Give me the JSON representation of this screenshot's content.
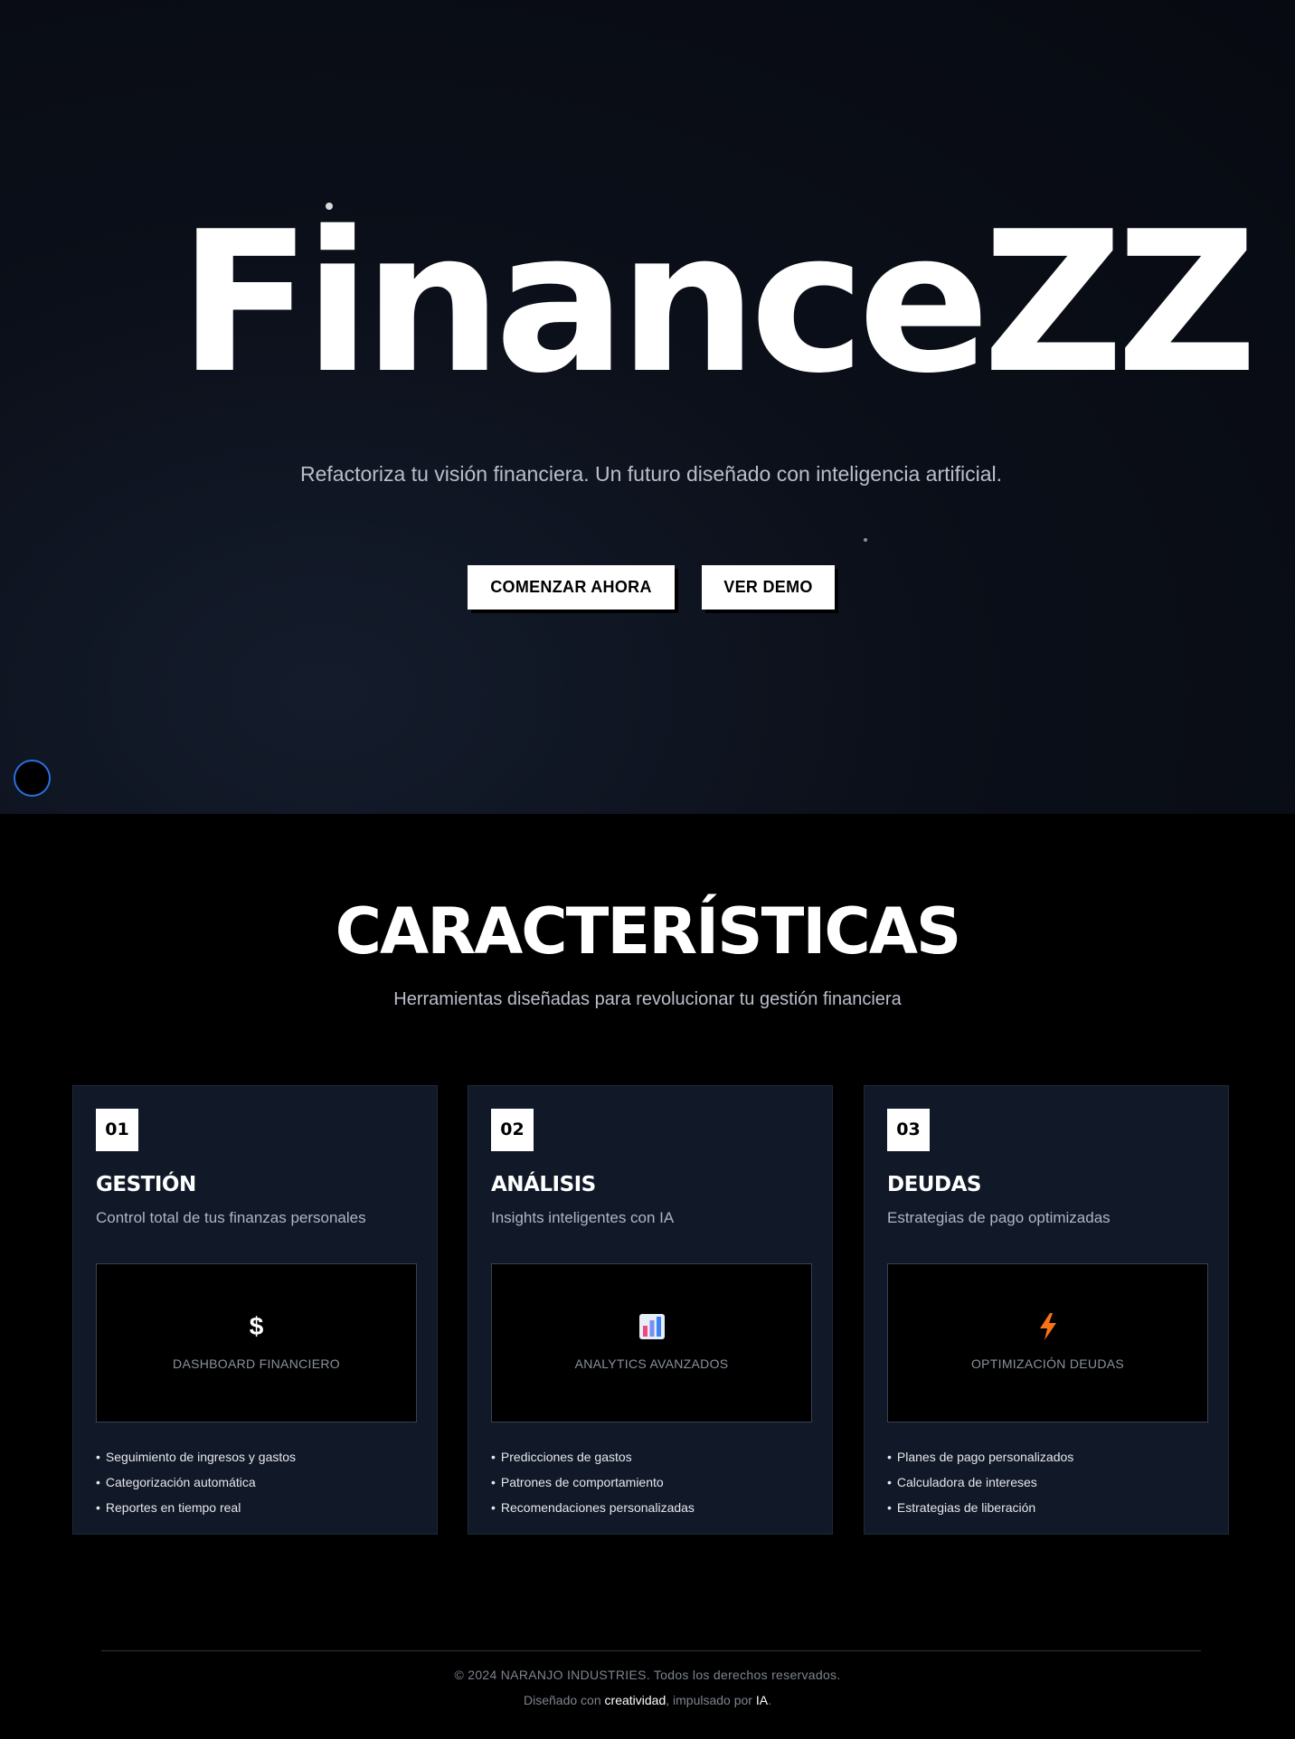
{
  "hero": {
    "brand": "FinanceZZ",
    "tagline": "Refactoriza tu visión financiera. Un futuro diseñado con inteligencia artificial.",
    "primary_button": "COMENZAR AHORA",
    "secondary_button": "VER DEMO"
  },
  "features": {
    "title": "CARACTERÍSTICAS",
    "subtitle": "Herramientas diseñadas para revolucionar tu gestión financiera",
    "cards": [
      {
        "number": "01",
        "title": "GESTIÓN",
        "description": "Control total de tus finanzas personales",
        "preview_icon": "$",
        "preview_icon_name": "dollar-icon",
        "preview_label": "DASHBOARD FINANCIERO",
        "bullets": [
          "Seguimiento de ingresos y gastos",
          "Categorización automática",
          "Reportes en tiempo real"
        ]
      },
      {
        "number": "02",
        "title": "ANÁLISIS",
        "description": "Insights inteligentes con IA",
        "preview_icon_name": "bar-chart-icon",
        "preview_label": "ANALYTICS AVANZADOS",
        "bullets": [
          "Predicciones de gastos",
          "Patrones de comportamiento",
          "Recomendaciones personalizadas"
        ]
      },
      {
        "number": "03",
        "title": "DEUDAS",
        "description": "Estrategias de pago optimizadas",
        "preview_icon_name": "lightning-icon",
        "preview_label": "OPTIMIZACIÓN DEUDAS",
        "bullets": [
          "Planes de pago personalizados",
          "Calculadora de intereses",
          "Estrategias de liberación"
        ]
      }
    ]
  },
  "footer": {
    "copyright": "© 2024 NARANJO INDUSTRIES. Todos los derechos reservados.",
    "credit_prefix": "Diseñado con ",
    "credit_word1": "creatividad",
    "credit_middle": ", impulsado por ",
    "credit_word2": "IA",
    "credit_suffix": "."
  },
  "colors": {
    "card_bg": "#111827",
    "toggle_ring": "#2b6fe0",
    "lightning": "#f97316"
  }
}
